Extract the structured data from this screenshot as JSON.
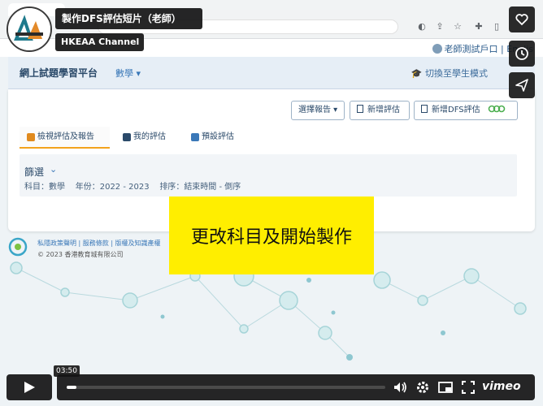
{
  "video": {
    "title": "製作DFS評估短片（老師）",
    "channel": "HKEAA Channel",
    "current_time": "03:50",
    "progress": 0.03,
    "player_brand": "vimeo",
    "caption": "更改科目及開始製作"
  },
  "site": {
    "title": "網上試題學習平台",
    "subject_menu": "數學",
    "switch_mode": "切換至學生模式",
    "user_account": "老師測試戶口 | Englis"
  },
  "toolbar": {
    "report_select": "選擇報告",
    "new_assessment": "新增評估",
    "new_dfs_assessment": "新增DFS評估"
  },
  "tabs": [
    {
      "label": "檢視評估及報告",
      "active": true
    },
    {
      "label": "我的評估",
      "active": false
    },
    {
      "label": "預設評估",
      "active": false
    }
  ],
  "filter": {
    "title": "篩選",
    "subject_label": "科目",
    "subject_value": "數學",
    "year_label": "年份",
    "year_value": "2022 - 2023",
    "sort_label": "排序",
    "sort_value": "結束時間 - 倒序"
  },
  "footer": {
    "privacy": "私隱政策聲明",
    "terms": "服務條款",
    "copyright_notice": "版權及知識產權",
    "copyright": "© 2023 香港教育城有限公司"
  },
  "colors": {
    "caption_bg": "#ffee00",
    "tab_accent": "#f3a21c",
    "header_bg": "#e6eef6",
    "link": "#3a78b8"
  }
}
